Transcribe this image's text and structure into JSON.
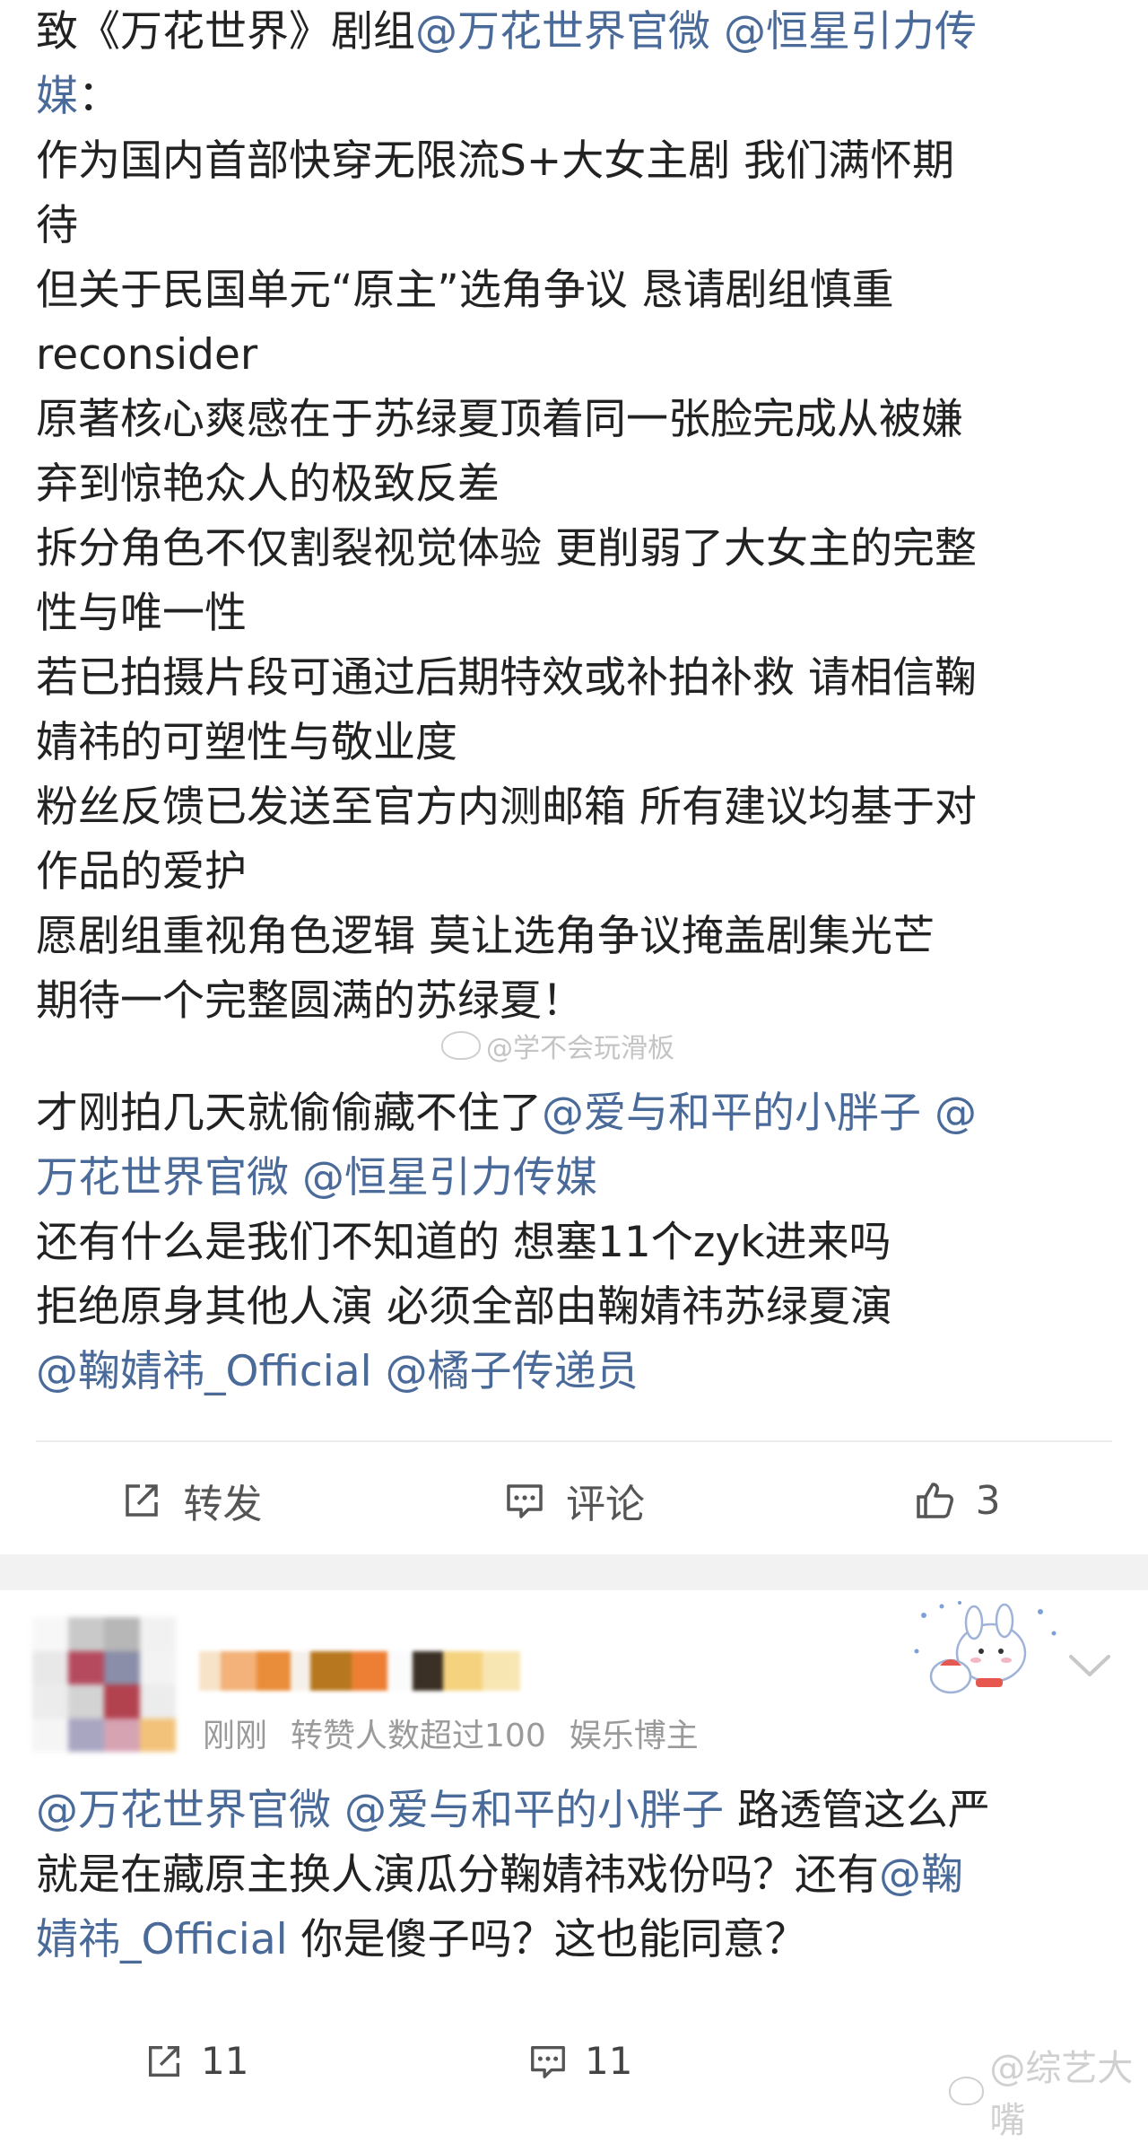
{
  "post1": {
    "paragraph1": [
      [
        {
          "t": "致《万花世界》剧组"
        },
        {
          "t": "@万花世界官微 @恒星引力传",
          "m": true
        }
      ],
      [
        {
          "t": "媒",
          "m": true
        },
        {
          "t": "："
        }
      ],
      [
        {
          "t": "作为国内首部快穿无限流S+大女主剧 我们满怀期"
        }
      ],
      [
        {
          "t": "待"
        }
      ],
      [
        {
          "t": "但关于民国单元“原主”选角争议 恳请剧组慎重"
        }
      ],
      [
        {
          "t": "reconsider"
        }
      ],
      [
        {
          "t": "原著核心爽感在于苏绿夏顶着同一张脸完成从被嫌"
        }
      ],
      [
        {
          "t": "弃到惊艳众人的极致反差"
        }
      ],
      [
        {
          "t": "拆分角色不仅割裂视觉体验 更削弱了大女主的完整"
        }
      ],
      [
        {
          "t": "性与唯一性"
        }
      ],
      [
        {
          "t": "若已拍摄片段可通过后期特效或补拍补救 请相信鞠"
        }
      ],
      [
        {
          "t": "婧祎的可塑性与敬业度"
        }
      ],
      [
        {
          "t": "粉丝反馈已发送至官方内测邮箱 所有建议均基于对"
        }
      ],
      [
        {
          "t": "作品的爱护"
        }
      ],
      [
        {
          "t": "愿剧组重视角色逻辑 莫让选角争议掩盖剧集光芒"
        }
      ],
      [
        {
          "t": "期待一个完整圆满的苏绿夏！"
        }
      ]
    ],
    "watermark": "@学不会玩滑板",
    "paragraph2": [
      [
        {
          "t": "才刚拍几天就偷偷藏不住了"
        },
        {
          "t": "@爱与和平的小胖子 @",
          "m": true
        }
      ],
      [
        {
          "t": "万花世界官微 @恒星引力传媒",
          "m": true
        }
      ],
      [
        {
          "t": "还有什么是我们不知道的 想塞11个zyk进来吗"
        }
      ],
      [
        {
          "t": "拒绝原身其他人演 必须全部由鞠婧祎苏绿夏演"
        }
      ],
      [
        {
          "t": "@鞠婧祎_Official @橘子传递员",
          "m": true
        }
      ]
    ],
    "actions": {
      "repost_label": "转发",
      "comment_label": "评论",
      "like_count": "3"
    }
  },
  "post2": {
    "meta_time": "刚刚",
    "meta_stats": "转赞人数超过100",
    "meta_role": "娱乐博主",
    "content": [
      [
        {
          "t": "@万花世界官微 @爱与和平的小胖子",
          "m": true
        },
        {
          "t": " 路透管这么严"
        }
      ],
      [
        {
          "t": "就是在藏原主换人演瓜分鞠婧祎戏份吗？还有"
        },
        {
          "t": "@鞠",
          "m": true
        }
      ],
      [
        {
          "t": "婧祎_Official",
          "m": true
        },
        {
          "t": " 你是傻子吗？这也能同意？"
        }
      ]
    ],
    "actions": {
      "repost_count": "11",
      "comment_count": "11"
    },
    "watermark": "@综艺大嘴"
  },
  "colors": {
    "mention": "#4a6a99",
    "text": "#222222",
    "meta": "#9a9a9a",
    "separator": "#f2f2f2"
  },
  "icons": [
    "repost-icon",
    "comment-icon",
    "like-icon",
    "chevron-down-icon",
    "weibo-logo-icon"
  ]
}
